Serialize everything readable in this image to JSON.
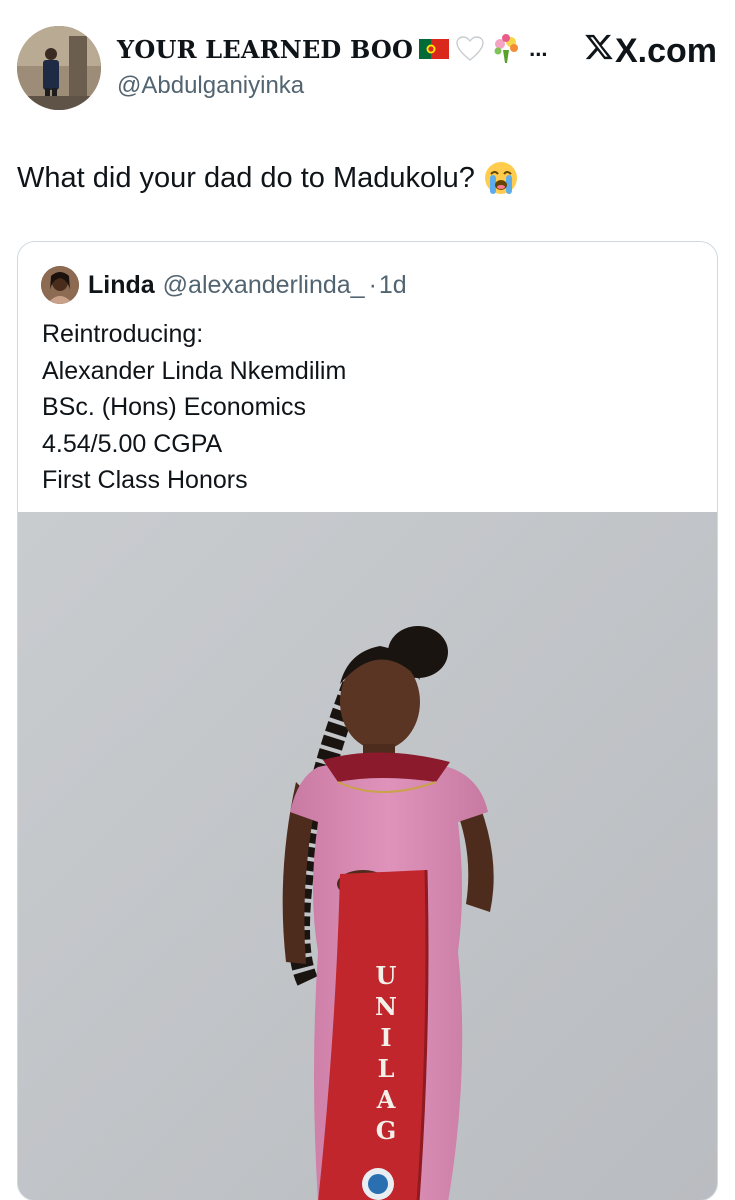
{
  "author": {
    "display_name": "YOUR LEARNED BOO",
    "handle": "@Abdulganiyinka",
    "ellipsis": "...",
    "emoji_icons": [
      "portugal-flag-icon",
      "white-heart-icon",
      "bouquet-icon"
    ]
  },
  "source_label": "X.com",
  "tweet": {
    "text": "What did your dad do to Madukolu?",
    "emoji_icon": "loudly-crying-face-icon"
  },
  "quoted_tweet": {
    "name": "Linda",
    "handle": "@alexanderlinda_",
    "separator": "·",
    "time": "1d",
    "lines": [
      "Reintroducing:",
      "Alexander Linda Nkemdilim",
      "BSc. (Hons) Economics",
      "4.54/5.00 CGPA",
      "First Class Honors"
    ],
    "photo": {
      "sash_letters": [
        "U",
        "N",
        "I",
        "L",
        "A",
        "G"
      ],
      "dress_color": "#d98ab3",
      "sash_color": "#c0262c",
      "background_color": "#c4c7cb"
    }
  },
  "colors": {
    "text_primary": "#0f1419",
    "text_secondary": "#536471",
    "border": "#cfd9de"
  }
}
